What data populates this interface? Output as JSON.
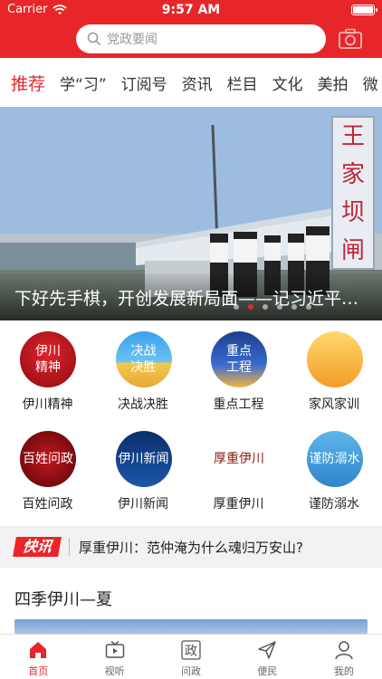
{
  "colors": {
    "brand": "#e8262a"
  },
  "status_bar": {
    "carrier": "Carrier",
    "time": "9:57 AM",
    "battery_level": 1.0
  },
  "search": {
    "placeholder": "党政要闻",
    "icon": "search-icon"
  },
  "header": {
    "camera_icon": "camera-icon"
  },
  "tabs": [
    {
      "label": "推荐",
      "active": true
    },
    {
      "label": "学“习”",
      "active": false
    },
    {
      "label": "订阅号",
      "active": false
    },
    {
      "label": "资讯",
      "active": false
    },
    {
      "label": "栏目",
      "active": false
    },
    {
      "label": "文化",
      "active": false
    },
    {
      "label": "美拍",
      "active": false
    },
    {
      "label": "微",
      "active": false
    }
  ],
  "hero": {
    "caption": "下好先手棋，开创发展新局面——记习近平…",
    "sign_text": "王家坝闸",
    "slide_count": 6,
    "active_slide": 1
  },
  "grid": [
    {
      "label": "伊川精神",
      "icon_text": "伊川\n精神"
    },
    {
      "label": "决战决胜",
      "icon_text": "决战\n决胜"
    },
    {
      "label": "重点工程",
      "icon_text": "重点\n工程"
    },
    {
      "label": "家风家训",
      "icon_text": ""
    },
    {
      "label": "百姓问政",
      "icon_text": "百姓问政"
    },
    {
      "label": "伊川新闻",
      "icon_text": "伊川新闻"
    },
    {
      "label": "厚重伊川",
      "icon_text": "厚重伊川"
    },
    {
      "label": "谨防溺水",
      "icon_text": "谨防溺水"
    }
  ],
  "quick_news": {
    "badge": "快讯",
    "text": "厚重伊川：范仲淹为什么魂归万安山?"
  },
  "section_title": "四季伊川—夏",
  "bottom_nav": [
    {
      "label": "首页",
      "icon": "home-icon",
      "active": true
    },
    {
      "label": "视听",
      "icon": "tv-icon",
      "active": false
    },
    {
      "label": "问政",
      "icon": "zheng-icon",
      "icon_text": "政",
      "active": false
    },
    {
      "label": "便民",
      "icon": "send-icon",
      "active": false
    },
    {
      "label": "我的",
      "icon": "user-icon",
      "active": false
    }
  ]
}
